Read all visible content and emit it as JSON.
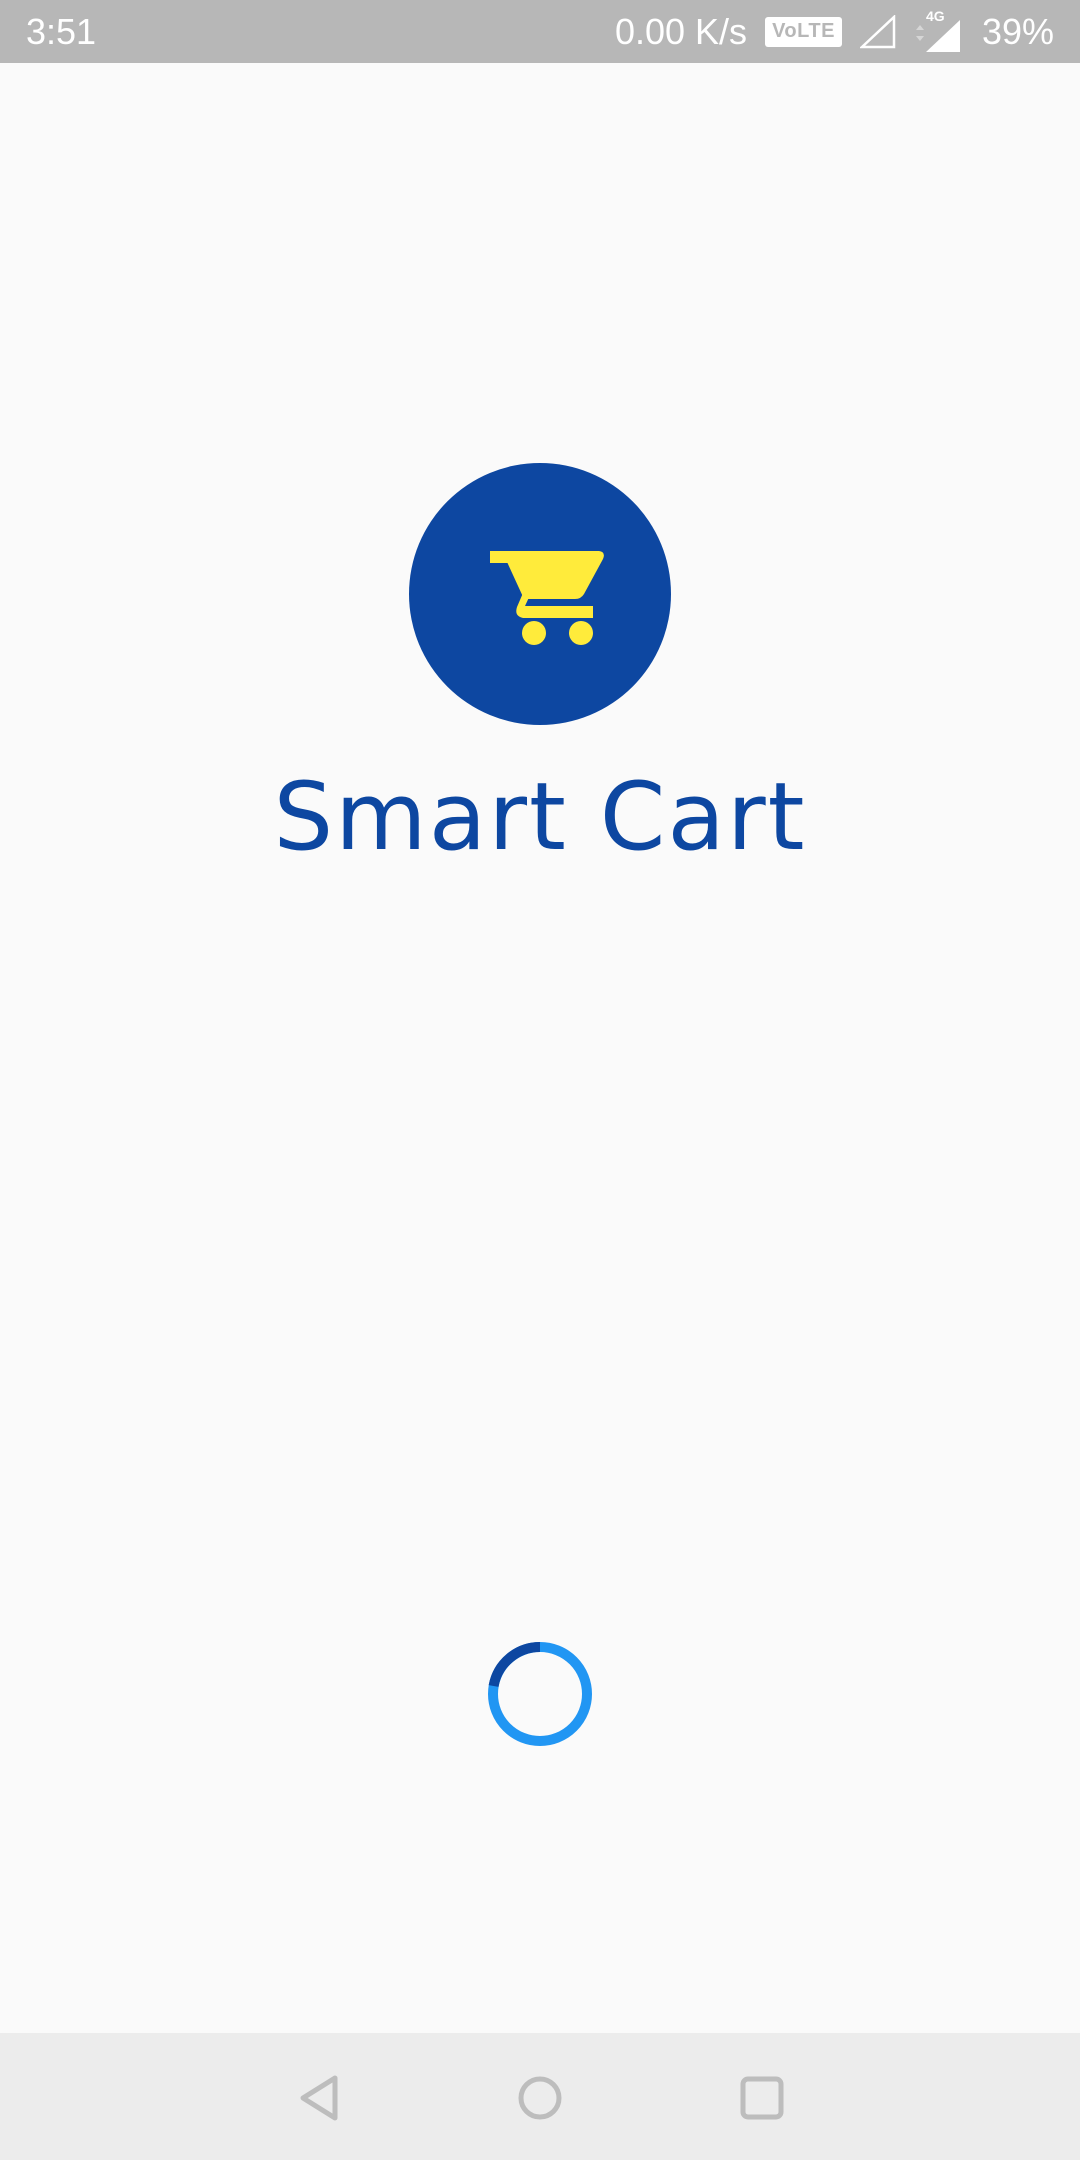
{
  "status_bar": {
    "time": "3:51",
    "network_speed": "0.00 K/s",
    "volte_label": "VoLTE",
    "network_type": "4G",
    "battery": "39%",
    "icons": [
      "signal-empty-icon",
      "signal-full-icon"
    ]
  },
  "splash": {
    "app_name": "Smart Cart",
    "logo_icon": "shopping-cart-icon",
    "colors": {
      "primary": "#0d47a1",
      "accent": "#ffeb3b",
      "spinner": "#2196f3",
      "background": "#fafafa"
    },
    "loading": true
  },
  "nav_bar": {
    "buttons": [
      "back-icon",
      "home-icon",
      "recents-icon"
    ]
  }
}
